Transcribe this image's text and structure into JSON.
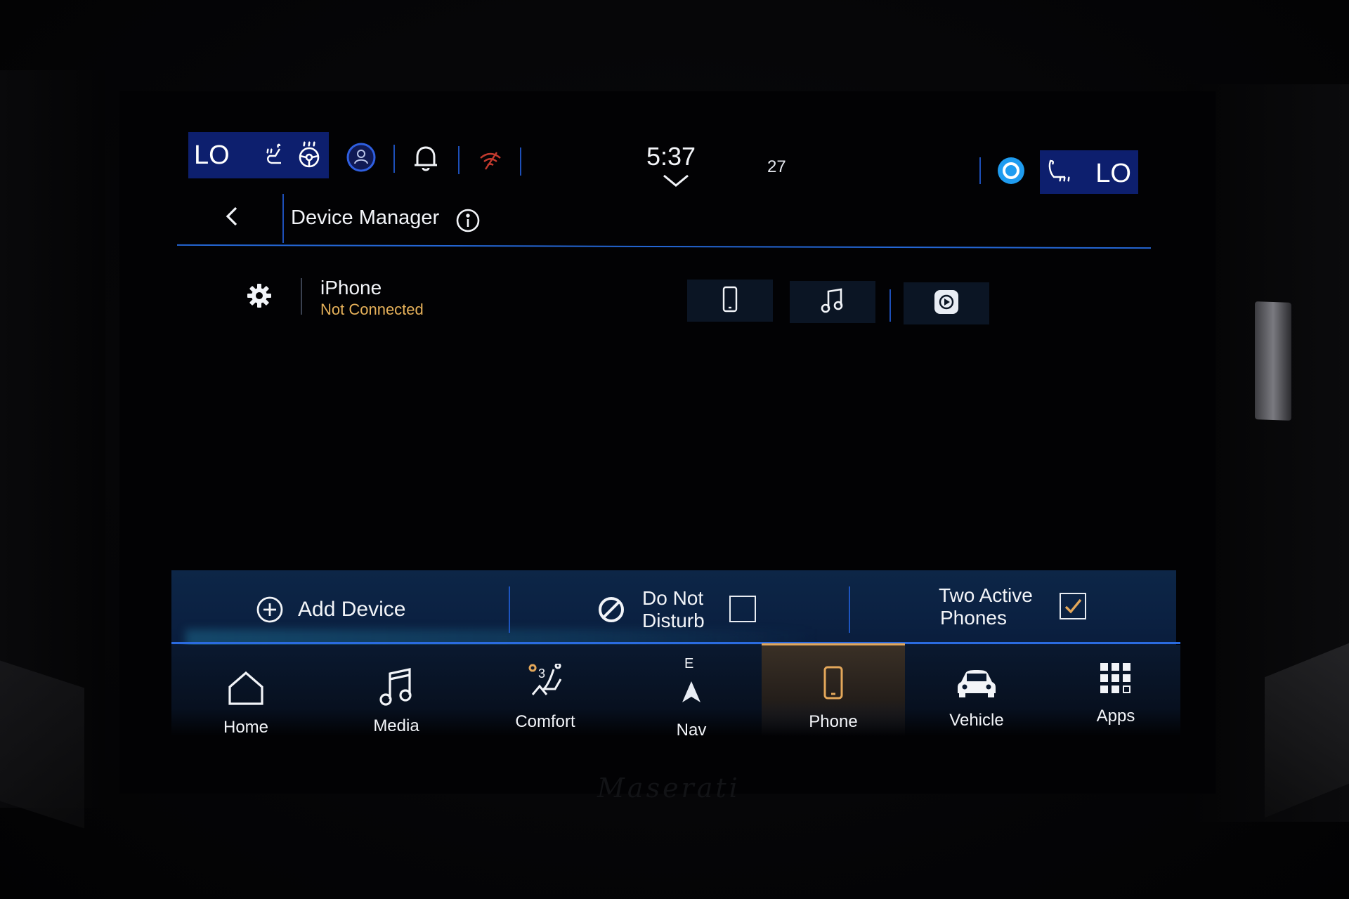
{
  "status_bar": {
    "left_temp": "LO",
    "right_temp": "LO",
    "clock": "5:37",
    "outside_temp": "27",
    "icons": [
      "seat-heat-icon",
      "steering-heat-icon",
      "driver-profile-icon",
      "bell-icon",
      "no-wifi-icon",
      "voice-assistant-icon",
      "passenger-seat-heat-icon"
    ]
  },
  "header": {
    "title": "Device Manager"
  },
  "device": {
    "name": "iPhone",
    "status": "Not Connected"
  },
  "actions": {
    "add_device": "Add Device",
    "dnd_line1": "Do Not",
    "dnd_line2": "Disturb",
    "dnd_checked": false,
    "two_line1": "Two Active",
    "two_line2": "Phones",
    "two_checked": true
  },
  "nav": {
    "nav_heading": "E",
    "items": [
      {
        "label": "Home",
        "icon": "home-icon"
      },
      {
        "label": "Media",
        "icon": "music-note-icon"
      },
      {
        "label": "Comfort",
        "icon": "seat-fan-icon"
      },
      {
        "label": "Nav",
        "icon": "navigation-arrow-icon"
      },
      {
        "label": "Phone",
        "icon": "phone-icon"
      },
      {
        "label": "Vehicle",
        "icon": "car-icon"
      },
      {
        "label": "Apps",
        "icon": "apps-grid-icon"
      }
    ],
    "active": "Phone"
  },
  "colors": {
    "accent_blue": "#2466d4",
    "status_orange": "#e6b15a",
    "temp_box": "#0d1f6e"
  }
}
